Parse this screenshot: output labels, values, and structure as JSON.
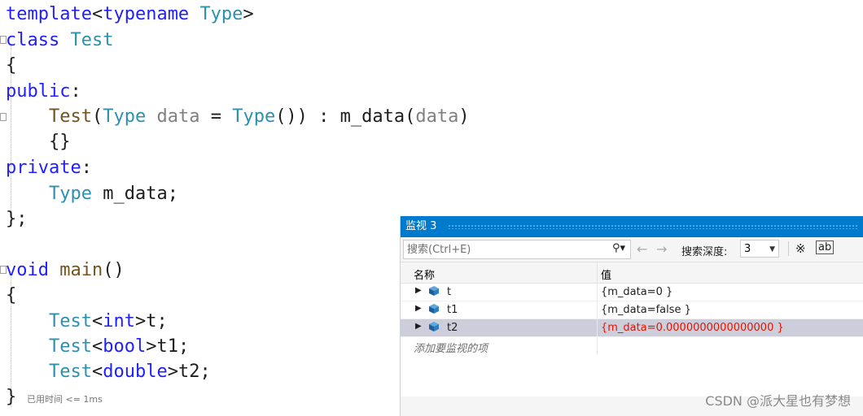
{
  "editor": {
    "lines": {
      "l1": {
        "kw": "template",
        "lt": "<",
        "kw2": "typename",
        "sp": " ",
        "ty": "Type",
        "gt": ">"
      },
      "l2": {
        "kw": "class",
        "sp": " ",
        "ty": "Test"
      },
      "l3": {
        "txt": "{"
      },
      "l4": {
        "kw": "public",
        "colon": ":"
      },
      "l5": {
        "fn": "Test",
        "p1": "(",
        "ty": "Type",
        "sp": " ",
        "pm": "data",
        "eq": " = ",
        "ty2": "Type",
        "p2": "()) : ",
        "mem": "m_data",
        "p3": "(",
        "pm2": "data",
        "p4": ")"
      },
      "l6": {
        "txt": "{}"
      },
      "l7": {
        "kw": "private",
        "colon": ":"
      },
      "l8": {
        "ty": "Type",
        "rest": " m_data;"
      },
      "l9": {
        "txt": "};"
      },
      "l10": {
        "kw": "void",
        "sp": " ",
        "fn": "main",
        "rest": "()"
      },
      "l11": {
        "txt": "{"
      },
      "l12": {
        "ty": "Test",
        "lt": "<",
        "kw": "int",
        "gt": ">",
        "rest": "t;"
      },
      "l13": {
        "ty": "Test",
        "lt": "<",
        "kw": "bool",
        "gt": ">",
        "rest": "t1;"
      },
      "l14": {
        "ty": "Test",
        "lt": "<",
        "kw": "double",
        "gt": ">",
        "rest": "t2;"
      },
      "l15": {
        "txt": "}"
      }
    },
    "timing": "已用时间 <= 1ms"
  },
  "watch": {
    "title": "监视 3",
    "search_placeholder": "搜索(Ctrl+E)",
    "search_icon": "search-icon",
    "depth_label": "搜索深度:",
    "depth_value": "3",
    "columns": {
      "name": "名称",
      "value": "值"
    },
    "rows": [
      {
        "name": "t",
        "value": "{m_data=0 }"
      },
      {
        "name": "t1",
        "value": "{m_data=false }"
      },
      {
        "name": "t2",
        "value": "{m_data=0.0000000000000000 }"
      }
    ],
    "add_hint": "添加要监视的项",
    "colors": {
      "title_bar": "#007acc",
      "changed_value": "#e51400",
      "selected_row": "#cccedb"
    }
  },
  "watermark": "CSDN @派大星也有梦想"
}
